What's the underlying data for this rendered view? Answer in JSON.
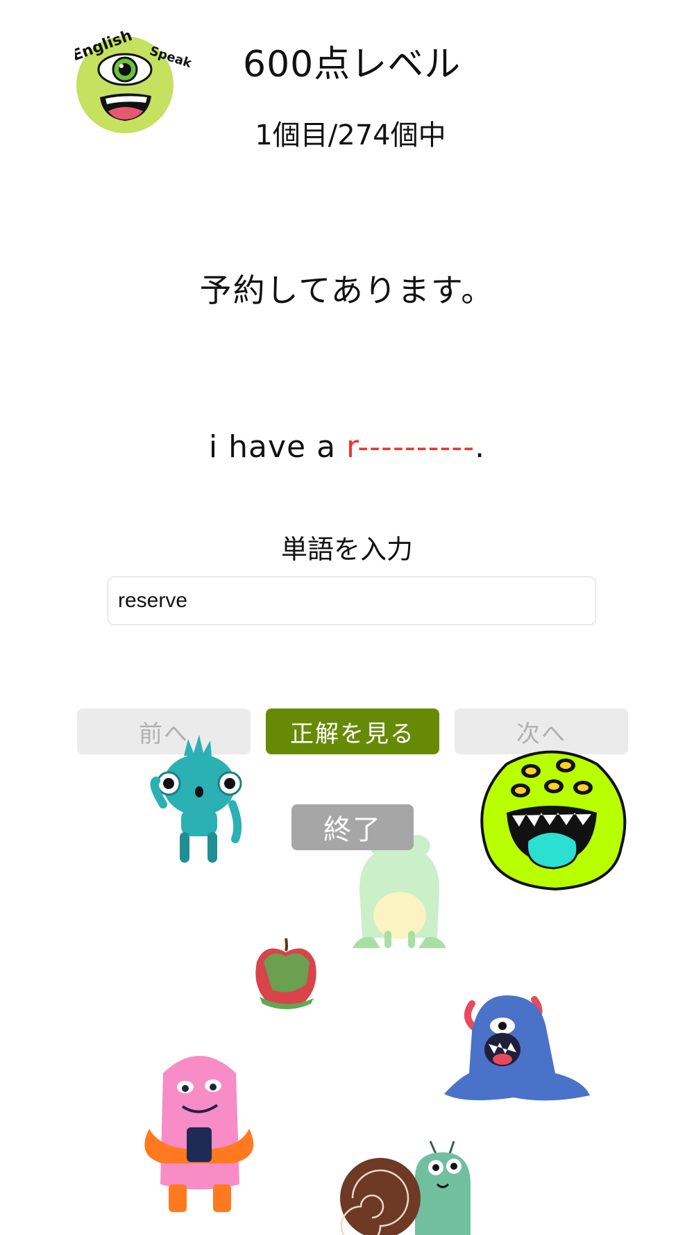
{
  "header": {
    "logo": {
      "top_text": "English",
      "side_text": "Speak",
      "icon": "one-eyed-monster-logo"
    },
    "title": "600点レベル",
    "progress": "1個目/274個中"
  },
  "question": {
    "japanese": "予約してあります。",
    "english_prefix": "i have a ",
    "english_hint": "r----------",
    "english_suffix": "."
  },
  "answer": {
    "label": "単語を入力",
    "value": "reserve"
  },
  "buttons": {
    "prev": "前へ",
    "show_answer": "正解を見る",
    "next": "次へ",
    "finish": "終了"
  },
  "decorations": [
    "teal-monster-icon",
    "lime-many-eyed-monster-icon",
    "frog-icon",
    "apple-icon",
    "blue-horned-monster-icon",
    "pink-fluffy-monster-icon",
    "snail-icon"
  ],
  "colors": {
    "accent": "#678a05",
    "hint": "#f0342a",
    "disabled_bg": "#ebebeb",
    "disabled_text": "#b1b1b1",
    "finish_bg": "#a6a6a6"
  }
}
